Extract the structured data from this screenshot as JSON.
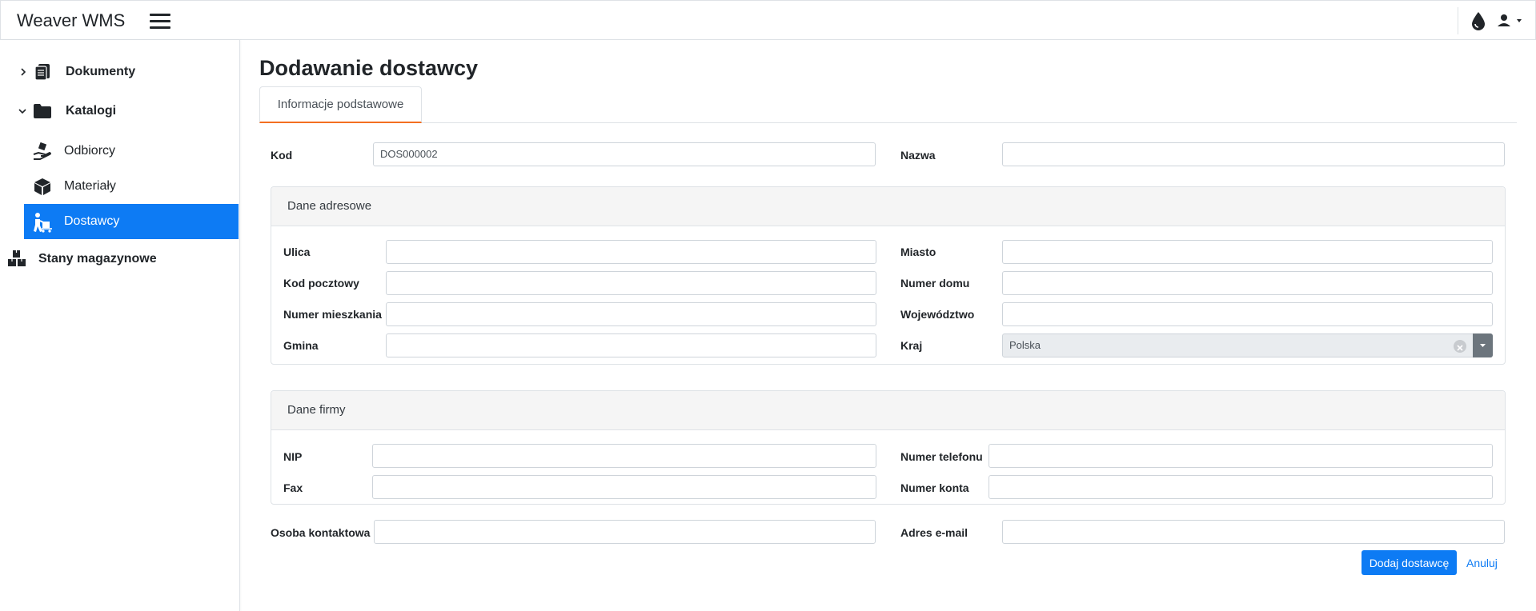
{
  "app": {
    "brand": "Weaver WMS"
  },
  "sidebar": {
    "items": [
      {
        "label": "Dokumenty"
      },
      {
        "label": "Katalogi"
      },
      {
        "label": "Odbiorcy"
      },
      {
        "label": "Materiały"
      },
      {
        "label": "Dostawcy"
      },
      {
        "label": "Stany magazynowe"
      }
    ]
  },
  "page": {
    "title": "Dodawanie dostawcy",
    "tab": "Informacje podstawowe"
  },
  "form": {
    "kod_label": "Kod",
    "kod_value": "DOS000002",
    "nazwa_label": "Nazwa",
    "address": {
      "title": "Dane adresowe",
      "ulica": "Ulica",
      "miasto": "Miasto",
      "kod_pocztowy": "Kod pocztowy",
      "numer_domu": "Numer domu",
      "numer_mieszkania": "Numer mieszkania",
      "wojewodztwo": "Województwo",
      "gmina": "Gmina",
      "kraj": "Kraj",
      "kraj_value": "Polska"
    },
    "company": {
      "title": "Dane firmy",
      "nip": "NIP",
      "numer_telefonu": "Numer telefonu",
      "fax": "Fax",
      "numer_konta": "Numer konta"
    },
    "osoba_kontaktowa": "Osoba kontaktowa",
    "adres_email": "Adres e-mail"
  },
  "actions": {
    "submit": "Dodaj dostawcę",
    "cancel": "Anuluj"
  },
  "colors": {
    "primary": "#0d7bf4",
    "tab_accent": "#f36f21",
    "select_toggle": "#6c757d"
  },
  "icons": {
    "menu": "hamburger-icon",
    "theme": "droplet-icon",
    "user": "user-icon",
    "dokumenty": "documents-icon",
    "katalogi": "folder-icon",
    "odbiorcy": "hand-holding-box-icon",
    "materialy": "cube-icon",
    "dostawcy": "people-carry-icon",
    "stany": "boxes-icon"
  }
}
